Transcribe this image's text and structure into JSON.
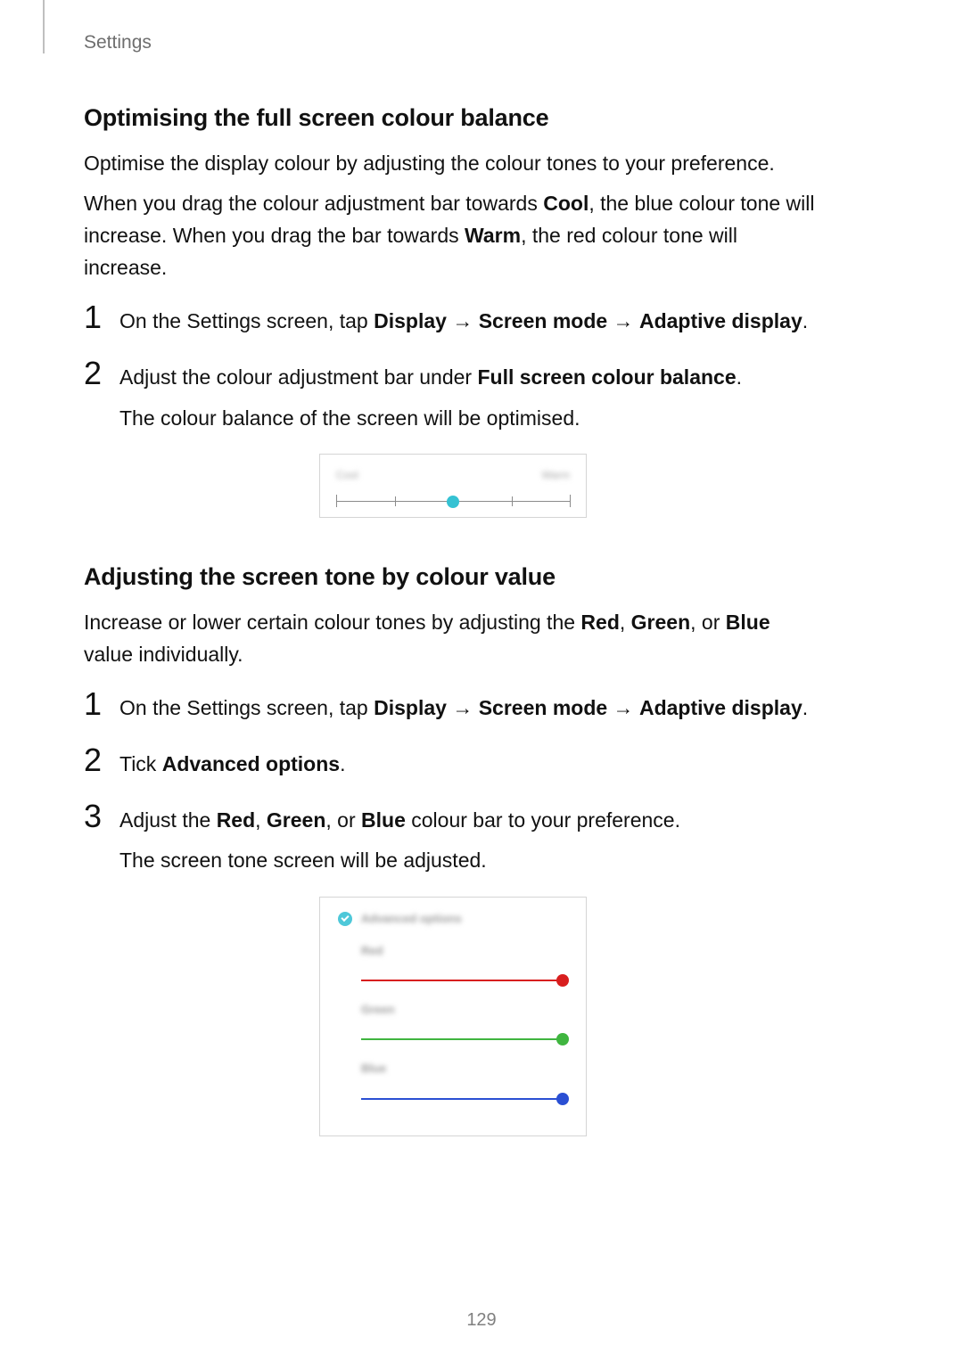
{
  "breadcrumb": "Settings",
  "page_number": "129",
  "section1": {
    "heading": "Optimising the full screen colour balance",
    "intro": "Optimise the display colour by adjusting the colour tones to your preference.",
    "detail_pre": "When you drag the colour adjustment bar towards ",
    "cool": "Cool",
    "detail_mid1": ", the blue colour tone will increase. When you drag the bar towards ",
    "warm": "Warm",
    "detail_post": ", the red colour tone will increase.",
    "steps": {
      "n1": "1",
      "s1_pre": "On the Settings screen, tap ",
      "display": "Display",
      "arrow": " → ",
      "screen_mode": "Screen mode",
      "adaptive": "Adaptive display",
      "period": ".",
      "n2": "2",
      "s2_pre": "Adjust the colour adjustment bar under ",
      "fscb": "Full screen colour balance",
      "s2_sub": "The colour balance of the screen will be optimised."
    },
    "figure": {
      "left_label": "Cool",
      "right_label": "Warm"
    }
  },
  "section2": {
    "heading": "Adjusting the screen tone by colour value",
    "intro_pre": "Increase or lower certain colour tones by adjusting the ",
    "red": "Red",
    "green": "Green",
    "blue": "Blue",
    "comma_sp": ", ",
    "or_sp": ", or ",
    "intro_post": " value individually.",
    "steps": {
      "n1": "1",
      "s1_pre": "On the Settings screen, tap ",
      "display": "Display",
      "arrow": " → ",
      "screen_mode": "Screen mode",
      "adaptive": "Adaptive display",
      "period": ".",
      "n2": "2",
      "s2_pre": "Tick ",
      "advopt": "Advanced options",
      "n3": "3",
      "s3_pre": "Adjust the ",
      "s3_post": " colour bar to your preference.",
      "s3_sub": "The screen tone screen will be adjusted."
    },
    "figure": {
      "advanced_label": "Advanced options",
      "red_label": "Red",
      "green_label": "Green",
      "blue_label": "Blue"
    }
  }
}
